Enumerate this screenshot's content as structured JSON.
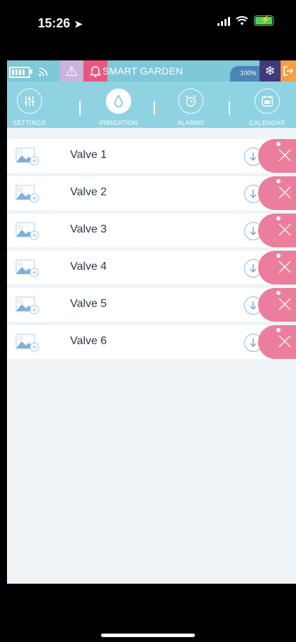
{
  "status_bar": {
    "time": "15:26"
  },
  "app": {
    "title": "SMART GARDEN",
    "battery_percent": "100%",
    "colors": {
      "topbar": "#7fc8d9",
      "tabbar": "#8fd2e2",
      "alarm": "#e8577e",
      "delete": "#eb7e9c",
      "snow": "#3f3a7a",
      "exit": "#f2a043"
    }
  },
  "tabs": [
    {
      "label": "SETTINGS",
      "icon": "sliders-icon"
    },
    {
      "label": "IRRIGATION",
      "icon": "water-drop-icon",
      "active": true
    },
    {
      "label": "ALARMS",
      "icon": "alarm-clock-icon"
    },
    {
      "label": "CALENDAR",
      "icon": "calendar-icon"
    }
  ],
  "valves": [
    {
      "name": "Valve 1"
    },
    {
      "name": "Valve 2"
    },
    {
      "name": "Valve 3"
    },
    {
      "name": "Valve 4"
    },
    {
      "name": "Valve 5"
    },
    {
      "name": "Valve 6"
    }
  ]
}
